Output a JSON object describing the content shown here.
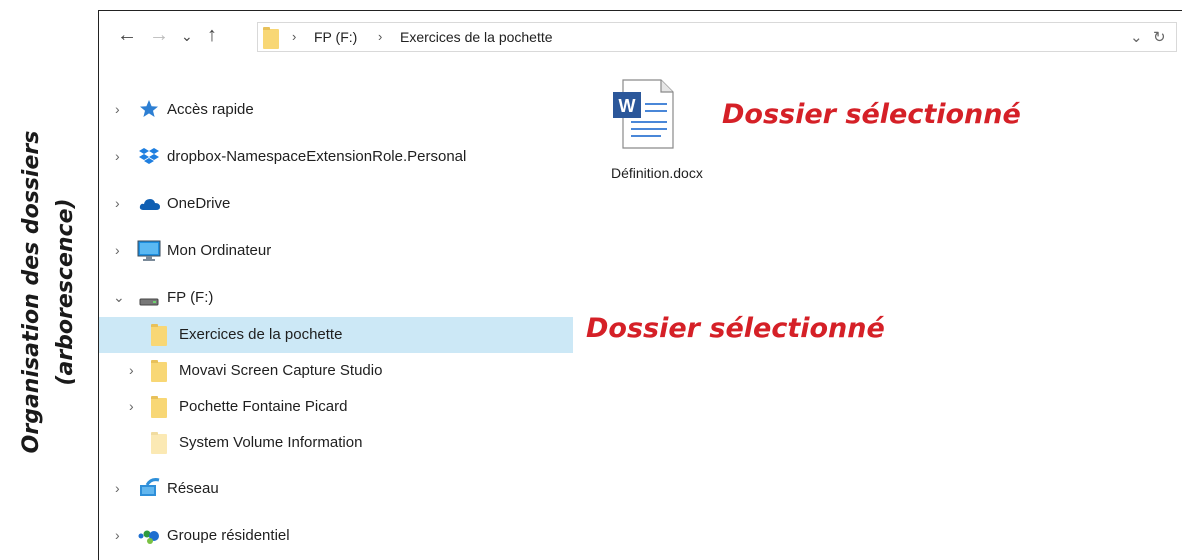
{
  "side_caption": {
    "line1": "Organisation des dossiers",
    "line2": "(arborescence)"
  },
  "toolbar": {
    "back_icon": "←",
    "forward_icon": "→",
    "recent_icon": "⌄",
    "up_icon": "↑"
  },
  "address": {
    "separator": "›",
    "crumbs": [
      "FP (F:)",
      "Exercices de la pochette"
    ],
    "dropdown_icon": "⌄",
    "refresh_icon": "↻"
  },
  "nav": {
    "expand_icon": "›",
    "collapse_icon": "⌄",
    "items": [
      {
        "label": "Accès rapide",
        "icon": "star-icon",
        "expanded": false
      },
      {
        "label": "dropbox-NamespaceExtensionRole.Personal",
        "icon": "dropbox-icon",
        "expanded": false
      },
      {
        "label": "OneDrive",
        "icon": "onedrive-icon",
        "expanded": false
      },
      {
        "label": "Mon Ordinateur",
        "icon": "computer-icon",
        "expanded": false
      },
      {
        "label": "FP (F:)",
        "icon": "drive-icon",
        "expanded": true
      },
      {
        "label": "Exercices de la pochette",
        "icon": "folder-icon",
        "selected": true
      },
      {
        "label": "Movavi Screen Capture Studio",
        "icon": "folder-icon"
      },
      {
        "label": "Pochette Fontaine Picard",
        "icon": "folder-icon"
      },
      {
        "label": "System Volume Information",
        "icon": "folder-icon"
      },
      {
        "label": "Réseau",
        "icon": "network-icon",
        "expanded": false
      },
      {
        "label": "Groupe résidentiel",
        "icon": "homegroup-icon",
        "expanded": false
      }
    ]
  },
  "content": {
    "file": {
      "name": "Définition.docx",
      "icon": "word-document-icon",
      "badge": "W"
    }
  },
  "annotations": {
    "top": "Dossier sélectionné",
    "middle": "Dossier sélectionné"
  },
  "colors": {
    "selection": "#cce8f6",
    "annotation": "#d52027"
  }
}
